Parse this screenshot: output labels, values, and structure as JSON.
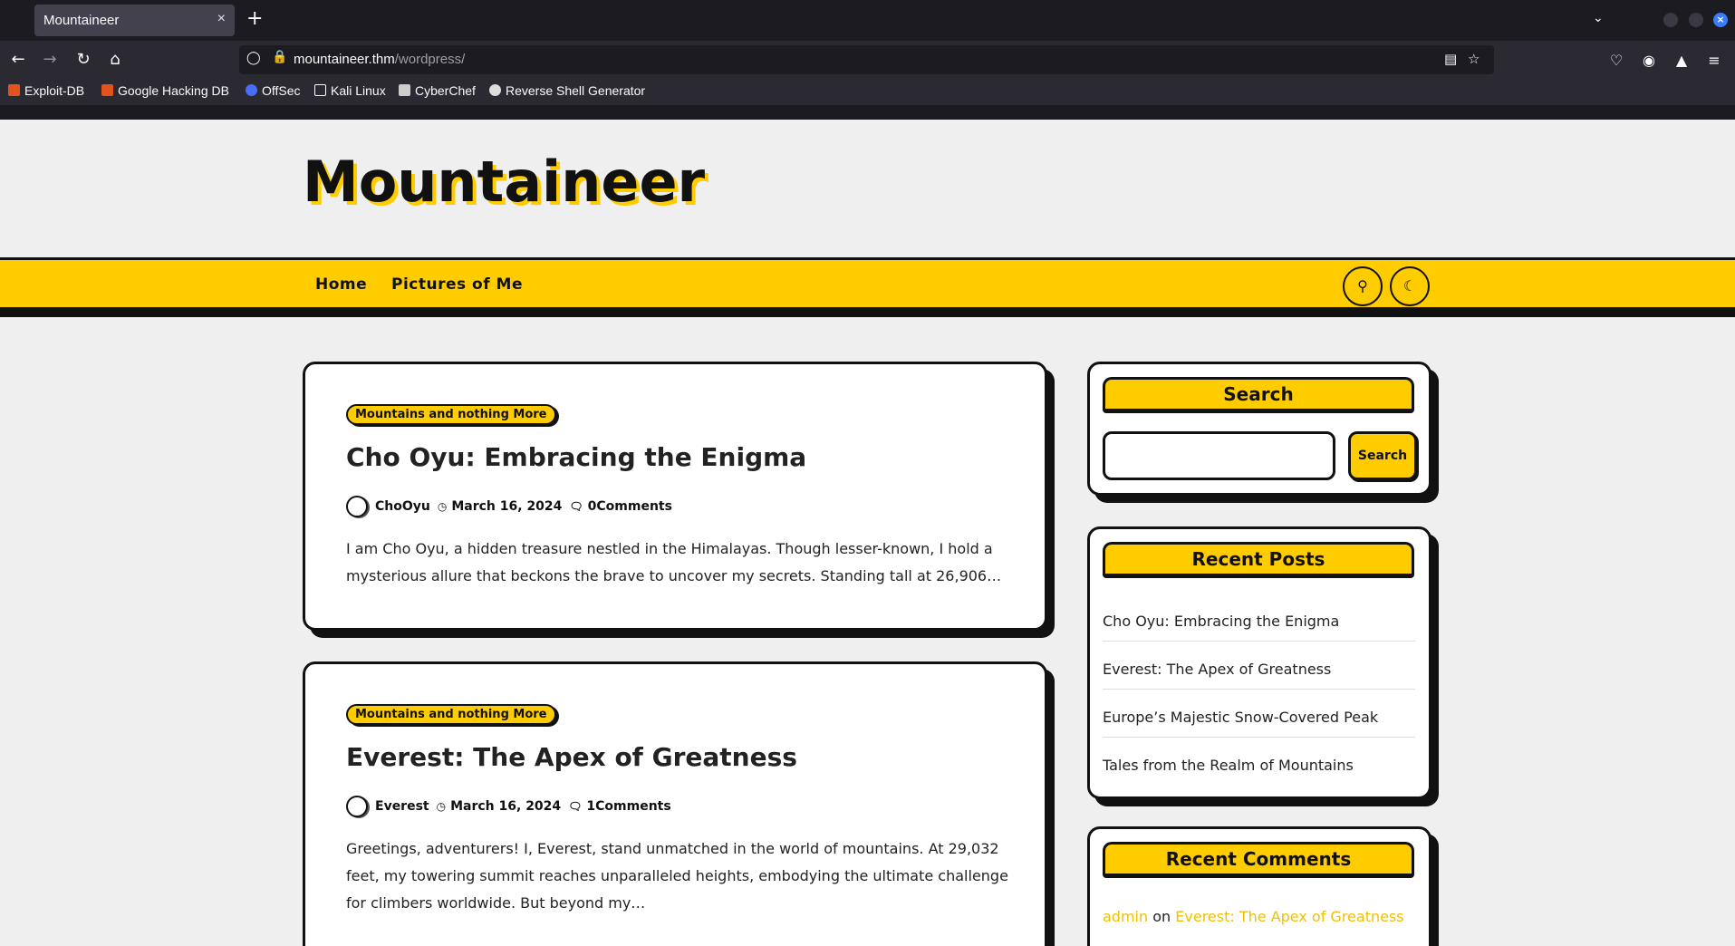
{
  "browser": {
    "tab_title": "Mountaineer",
    "tab_close": "×",
    "new_tab": "+",
    "url_host": "mountaineer.thm",
    "url_path": "/wordpress/",
    "bookmarks": [
      {
        "label": "Exploit-DB",
        "color": "#e2541b"
      },
      {
        "label": "Google Hacking DB",
        "color": "#e2541b"
      },
      {
        "label": "OffSec",
        "color": "#4a6cf7"
      },
      {
        "label": "Kali Linux",
        "color": "#ffffff"
      },
      {
        "label": "CyberChef",
        "color": "#cccccc"
      },
      {
        "label": "Reverse Shell Generator",
        "color": "#dddddd"
      }
    ]
  },
  "site": {
    "title": "Mountaineer",
    "accent_color": "#ffcc00",
    "menu": [
      "Home",
      "Pictures of Me"
    ]
  },
  "posts": [
    {
      "category": "Mountains and nothing More",
      "title": "Cho Oyu: Embracing the Enigma",
      "author": "ChoOyu",
      "date": "March 16, 2024",
      "comments": "0Comments",
      "excerpt_lines": [
        "I am Cho Oyu, a hidden treasure nestled in the Himalayas. Though lesser-known, I hold a",
        "mysterious allure that beckons the brave to uncover my secrets. Standing tall at 26,906…"
      ]
    },
    {
      "category": "Mountains and nothing More",
      "title": "Everest: The Apex of Greatness",
      "author": "Everest",
      "date": "March 16, 2024",
      "comments": "1Comments",
      "excerpt_lines": [
        "Greetings, adventurers! I, Everest, stand unmatched in the world of mountains. At 29,032",
        "feet, my towering summit reaches unparalleled heights, embodying the ultimate challenge",
        "for climbers worldwide. But beyond my…"
      ]
    }
  ],
  "sidebar": {
    "search_title": "Search",
    "search_button": "Search",
    "recent_posts_title": "Recent Posts",
    "recent_posts": [
      "Cho Oyu: Embracing the Enigma",
      "Everest: The Apex of Greatness",
      "Europe’s Majestic Snow-Covered Peak",
      "Tales from the Realm of Mountains"
    ],
    "recent_comments_title": "Recent Comments",
    "comment": {
      "author": "admin",
      "on": "on",
      "post": "Everest: The Apex of Greatness"
    }
  }
}
